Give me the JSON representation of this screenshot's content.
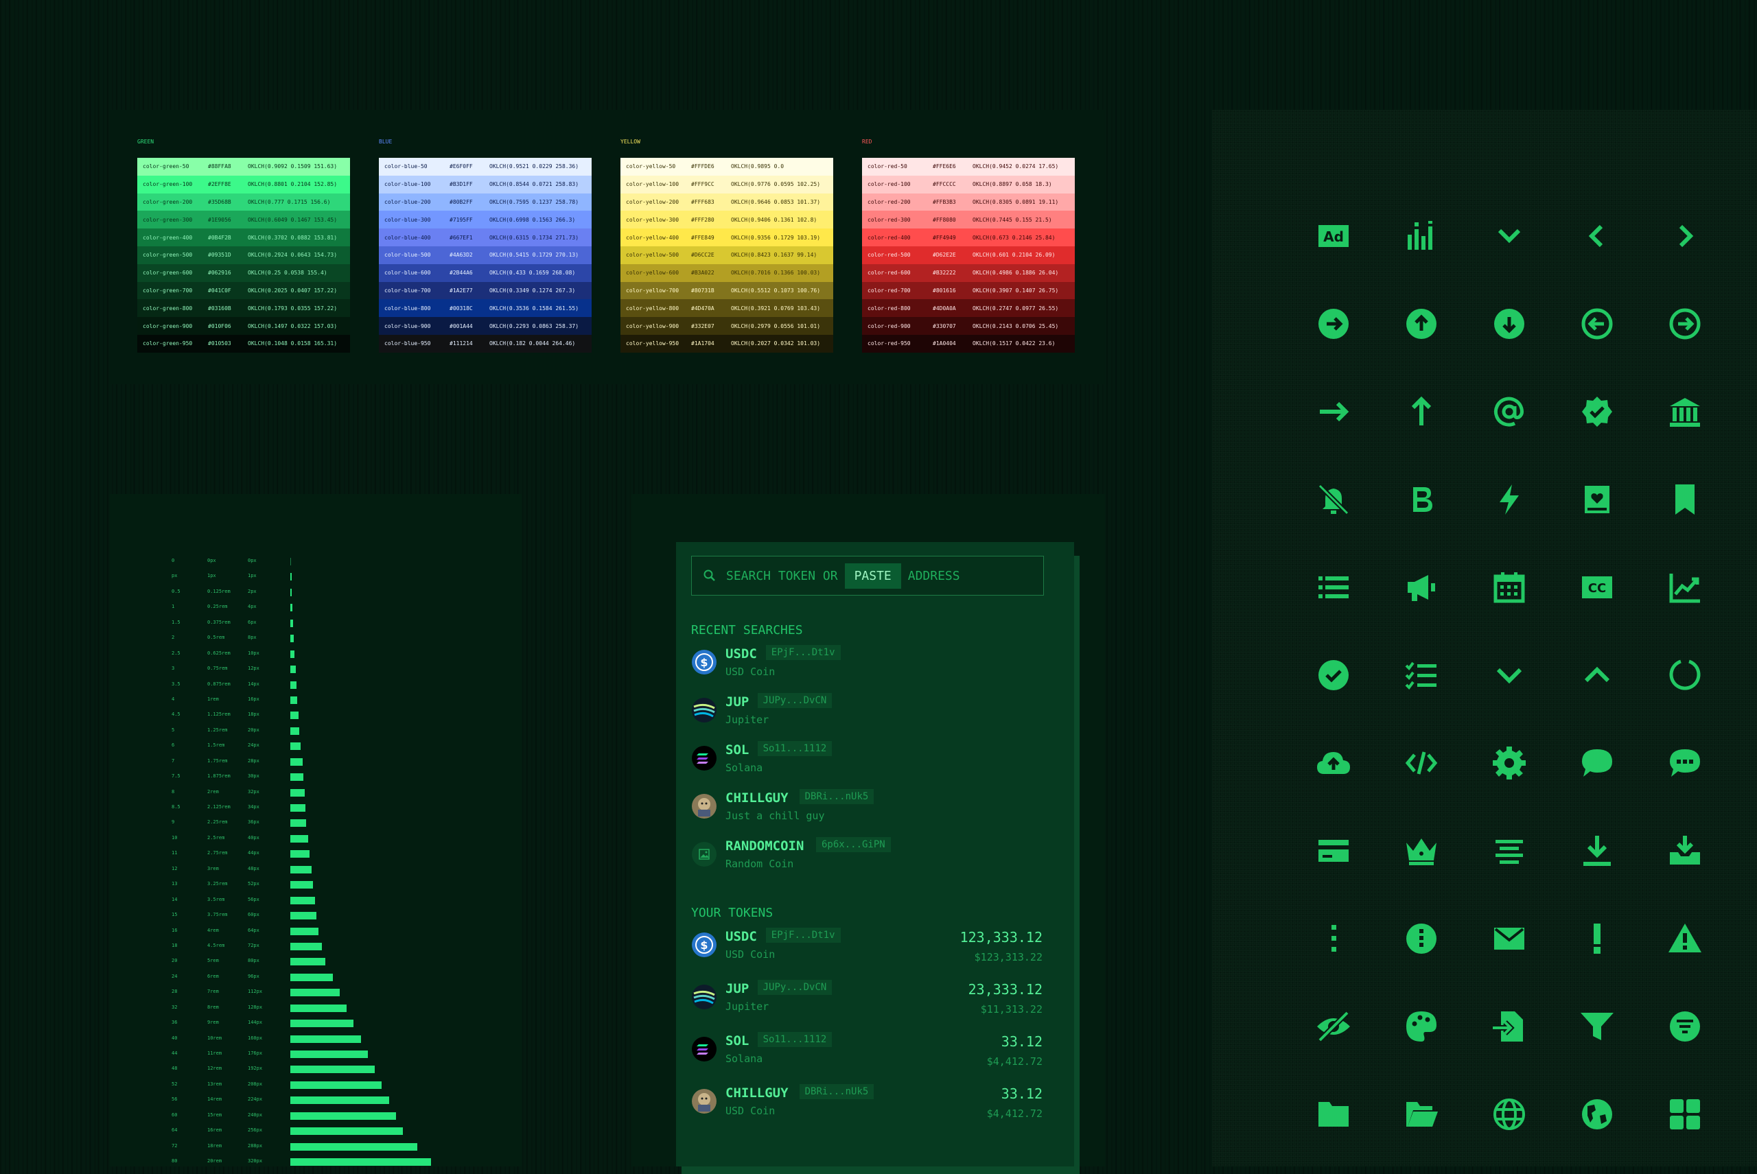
{
  "palettes": [
    {
      "title": "GREEN",
      "title_color": "#2edb78",
      "rows": [
        {
          "name": "color-green-50",
          "hex": "#88FFA8",
          "oklch": "OKLCH(0.9092 0.1509 151.63)",
          "bg": "#88ffa8",
          "fg": "#06351a"
        },
        {
          "name": "color-green-100",
          "hex": "#2EFF8E",
          "oklch": "OKLCH(0.8801 0.2104 152.85)",
          "bg": "#3cf98a",
          "fg": "#06351a"
        },
        {
          "name": "color-green-200",
          "hex": "#35D68B",
          "oklch": "OKLCH(0.777 0.1715 156.6)",
          "bg": "#2ed77a",
          "fg": "#06351a"
        },
        {
          "name": "color-green-300",
          "hex": "#1E9056",
          "oklch": "OKLCH(0.6049 0.1467 153.45)",
          "bg": "#1ba85a",
          "fg": "#06351a"
        },
        {
          "name": "color-green-400",
          "hex": "#0B4F2B",
          "oklch": "OKLCH(0.3702 0.0882 153.81)",
          "bg": "#0f7a3e",
          "fg": "#8ff2b8"
        },
        {
          "name": "color-green-500",
          "hex": "#09351D",
          "oklch": "OKLCH(0.2924 0.0643 154.73)",
          "bg": "#0b5c2f",
          "fg": "#8ff2b8"
        },
        {
          "name": "color-green-600",
          "hex": "#062916",
          "oklch": "OKLCH(0.25 0.0538 155.4)",
          "bg": "#094724",
          "fg": "#8ff2b8"
        },
        {
          "name": "color-green-700",
          "hex": "#041C0F",
          "oklch": "OKLCH(0.2025 0.0407 157.22)",
          "bg": "#07361c",
          "fg": "#8ff2b8"
        },
        {
          "name": "color-green-800",
          "hex": "#03160B",
          "oklch": "OKLCH(0.1793 0.0355 157.22)",
          "bg": "#052814",
          "fg": "#8ff2b8"
        },
        {
          "name": "color-green-900",
          "hex": "#010F06",
          "oklch": "OKLCH(0.1497 0.0322 157.03)",
          "bg": "#031a0d",
          "fg": "#8ff2b8"
        },
        {
          "name": "color-green-950",
          "hex": "#010503",
          "oklch": "OKLCH(0.1048 0.0158 165.31)",
          "bg": "#020a06",
          "fg": "#8ff2b8"
        }
      ]
    },
    {
      "title": "BLUE",
      "title_color": "#5d88ff",
      "rows": [
        {
          "name": "color-blue-50",
          "hex": "#E6F0FF",
          "oklch": "OKLCH(0.9521 0.0229 258.36)",
          "bg": "#e6f0ff",
          "fg": "#0b1b4a"
        },
        {
          "name": "color-blue-100",
          "hex": "#B3D1FF",
          "oklch": "OKLCH(0.8544 0.0721 258.83)",
          "bg": "#b6d0ff",
          "fg": "#0b1b4a"
        },
        {
          "name": "color-blue-200",
          "hex": "#80B2FF",
          "oklch": "OKLCH(0.7595 0.1237 258.78)",
          "bg": "#8fb5ff",
          "fg": "#0b1b4a"
        },
        {
          "name": "color-blue-300",
          "hex": "#7195FF",
          "oklch": "OKLCH(0.6998 0.1563 266.3)",
          "bg": "#7397ff",
          "fg": "#0b1b4a"
        },
        {
          "name": "color-blue-400",
          "hex": "#667EF1",
          "oklch": "OKLCH(0.6315 0.1734 271.73)",
          "bg": "#6a80f2",
          "fg": "#0b1b4a"
        },
        {
          "name": "color-blue-500",
          "hex": "#4A63D2",
          "oklch": "OKLCH(0.5415 0.1729 270.13)",
          "bg": "#4c66d6",
          "fg": "#e6f0ff"
        },
        {
          "name": "color-blue-600",
          "hex": "#2B44A6",
          "oklch": "OKLCH(0.433 0.1659 268.08)",
          "bg": "#2c46a8",
          "fg": "#e6f0ff"
        },
        {
          "name": "color-blue-700",
          "hex": "#1A2E77",
          "oklch": "OKLCH(0.3349 0.1274 267.3)",
          "bg": "#1b2f7a",
          "fg": "#e6f0ff"
        },
        {
          "name": "color-blue-800",
          "hex": "#00318C",
          "oklch": "OKLCH(0.3536 0.1584 261.55)",
          "bg": "#07318c",
          "fg": "#e6f0ff"
        },
        {
          "name": "color-blue-900",
          "hex": "#001A44",
          "oklch": "OKLCH(0.2293 0.0863 258.37)",
          "bg": "#0a1a44",
          "fg": "#e6f0ff"
        },
        {
          "name": "color-blue-950",
          "hex": "#111214",
          "oklch": "OKLCH(0.182 0.0044 264.46)",
          "bg": "#111214",
          "fg": "#e6f0ff"
        }
      ]
    },
    {
      "title": "YELLOW",
      "title_color": "#f1e15b",
      "rows": [
        {
          "name": "color-yellow-50",
          "hex": "#FFFDE6",
          "oklch": "OKLCH(0.9895 0.0",
          "bg": "#fffde6",
          "fg": "#3a3305"
        },
        {
          "name": "color-yellow-100",
          "hex": "#FFF9CC",
          "oklch": "OKLCH(0.9776 0.0595 102.25)",
          "bg": "#fff8c6",
          "fg": "#3a3305"
        },
        {
          "name": "color-yellow-200",
          "hex": "#FFF683",
          "oklch": "OKLCH(0.9646 0.0853 101.37)",
          "bg": "#fff39a",
          "fg": "#3a3305"
        },
        {
          "name": "color-yellow-300",
          "hex": "#FFF280",
          "oklch": "OKLCH(0.9406 0.1361 102.8)",
          "bg": "#ffee6e",
          "fg": "#3a3305"
        },
        {
          "name": "color-yellow-400",
          "hex": "#FFE849",
          "oklch": "OKLCH(0.9356 0.1729 103.19)",
          "bg": "#ffe84a",
          "fg": "#3a3305"
        },
        {
          "name": "color-yellow-500",
          "hex": "#D6CC2E",
          "oklch": "OKLCH(0.8423 0.1637 99.14)",
          "bg": "#d9c830",
          "fg": "#3a3305"
        },
        {
          "name": "color-yellow-600",
          "hex": "#B3A022",
          "oklch": "OKLCH(0.7016 0.1366 100.03)",
          "bg": "#b39f23",
          "fg": "#3a3305"
        },
        {
          "name": "color-yellow-700",
          "hex": "#80731B",
          "oklch": "OKLCH(0.5512 0.1073 100.76)",
          "bg": "#82741d",
          "fg": "#fff8c6"
        },
        {
          "name": "color-yellow-800",
          "hex": "#4D470A",
          "oklch": "OKLCH(0.3921 0.0769 103.43)",
          "bg": "#5a4f10",
          "fg": "#fff8c6"
        },
        {
          "name": "color-yellow-900",
          "hex": "#332E07",
          "oklch": "OKLCH(0.2979 0.0556 101.01)",
          "bg": "#3b340a",
          "fg": "#fff8c6"
        },
        {
          "name": "color-yellow-950",
          "hex": "#1A1704",
          "oklch": "OKLCH(0.2027 0.0342 101.03)",
          "bg": "#1e1b06",
          "fg": "#fff8c6"
        }
      ]
    },
    {
      "title": "RED",
      "title_color": "#ff5a5a",
      "rows": [
        {
          "name": "color-red-50",
          "hex": "#FFE6E6",
          "oklch": "OKLCH(0.9452 0.0274 17.65)",
          "bg": "#ffe6e6",
          "fg": "#3d0707"
        },
        {
          "name": "color-red-100",
          "hex": "#FFCCCC",
          "oklch": "OKLCH(0.8897 0.058 18.3)",
          "bg": "#ffc8c8",
          "fg": "#3d0707"
        },
        {
          "name": "color-red-200",
          "hex": "#FFB3B3",
          "oklch": "OKLCH(0.8305 0.0891 19.11)",
          "bg": "#ffa8a8",
          "fg": "#3d0707"
        },
        {
          "name": "color-red-300",
          "hex": "#FF8080",
          "oklch": "OKLCH(0.7445 0.155 21.5)",
          "bg": "#ff8080",
          "fg": "#3d0707"
        },
        {
          "name": "color-red-400",
          "hex": "#FF4949",
          "oklch": "OKLCH(0.673 0.2146 25.84)",
          "bg": "#ff4d4d",
          "fg": "#3d0707"
        },
        {
          "name": "color-red-500",
          "hex": "#D62E2E",
          "oklch": "OKLCH(0.601 0.2104 26.09)",
          "bg": "#e02c2c",
          "fg": "#ffe6e6"
        },
        {
          "name": "color-red-600",
          "hex": "#B32222",
          "oklch": "OKLCH(0.4986 0.1886 26.04)",
          "bg": "#b32222",
          "fg": "#ffe6e6"
        },
        {
          "name": "color-red-700",
          "hex": "#801616",
          "oklch": "OKLCH(0.3907 0.1407 26.75)",
          "bg": "#8a1818",
          "fg": "#ffe6e6"
        },
        {
          "name": "color-red-800",
          "hex": "#4D0A0A",
          "oklch": "OKLCH(0.2747 0.0977 26.55)",
          "bg": "#5d0d0d",
          "fg": "#ffe6e6"
        },
        {
          "name": "color-red-900",
          "hex": "#330707",
          "oklch": "OKLCH(0.2143 0.0706 25.45)",
          "bg": "#3b0808",
          "fg": "#ffe6e6"
        },
        {
          "name": "color-red-950",
          "hex": "#1A0404",
          "oklch": "OKLCH(0.1517 0.0422 23.6)",
          "bg": "#1e0505",
          "fg": "#ffe6e6"
        }
      ]
    }
  ],
  "spacing": [
    {
      "key": "0",
      "rem": "0px",
      "px": "0px",
      "frac": 0
    },
    {
      "key": "px",
      "rem": "1px",
      "px": "1px",
      "frac": 0.007
    },
    {
      "key": "0.5",
      "rem": "0.125rem",
      "px": "2px",
      "frac": 0.016
    },
    {
      "key": "1",
      "rem": "0.25rem",
      "px": "4px",
      "frac": 0.031
    },
    {
      "key": "1.5",
      "rem": "0.375rem",
      "px": "6px",
      "frac": 0.047
    },
    {
      "key": "2",
      "rem": "0.5rem",
      "px": "8px",
      "frac": 0.063
    },
    {
      "key": "2.5",
      "rem": "0.625rem",
      "px": "10px",
      "frac": 0.078
    },
    {
      "key": "3",
      "rem": "0.75rem",
      "px": "12px",
      "frac": 0.094
    },
    {
      "key": "3.5",
      "rem": "0.875rem",
      "px": "14px",
      "frac": 0.109
    },
    {
      "key": "4",
      "rem": "1rem",
      "px": "16px",
      "frac": 0.125
    },
    {
      "key": "4.5",
      "rem": "1.125rem",
      "px": "18px",
      "frac": 0.141
    },
    {
      "key": "5",
      "rem": "1.25rem",
      "px": "20px",
      "frac": 0.156
    },
    {
      "key": "6",
      "rem": "1.5rem",
      "px": "24px",
      "frac": 0.188
    },
    {
      "key": "7",
      "rem": "1.75rem",
      "px": "28px",
      "frac": 0.219
    },
    {
      "key": "7.5",
      "rem": "1.875rem",
      "px": "30px",
      "frac": 0.234
    },
    {
      "key": "8",
      "rem": "2rem",
      "px": "32px",
      "frac": 0.25
    },
    {
      "key": "8.5",
      "rem": "2.125rem",
      "px": "34px",
      "frac": 0.266
    },
    {
      "key": "9",
      "rem": "2.25rem",
      "px": "36px",
      "frac": 0.281
    },
    {
      "key": "10",
      "rem": "2.5rem",
      "px": "40px",
      "frac": 0.313
    },
    {
      "key": "11",
      "rem": "2.75rem",
      "px": "44px",
      "frac": 0.344
    },
    {
      "key": "12",
      "rem": "3rem",
      "px": "48px",
      "frac": 0.375
    },
    {
      "key": "13",
      "rem": "3.25rem",
      "px": "52px",
      "frac": 0.406
    },
    {
      "key": "14",
      "rem": "3.5rem",
      "px": "56px",
      "frac": 0.438
    },
    {
      "key": "15",
      "rem": "3.75rem",
      "px": "60px",
      "frac": 0.469
    },
    {
      "key": "16",
      "rem": "4rem",
      "px": "64px",
      "frac": 0.5
    },
    {
      "key": "18",
      "rem": "4.5rem",
      "px": "72px",
      "frac": 0.563
    },
    {
      "key": "20",
      "rem": "5rem",
      "px": "80px",
      "frac": 0.625
    },
    {
      "key": "24",
      "rem": "6rem",
      "px": "96px",
      "frac": 0.75
    },
    {
      "key": "28",
      "rem": "7rem",
      "px": "112px",
      "frac": 0.875
    },
    {
      "key": "32",
      "rem": "8rem",
      "px": "128px",
      "frac": 1.0
    },
    {
      "key": "36",
      "rem": "9rem",
      "px": "144px",
      "frac": 1.125
    },
    {
      "key": "40",
      "rem": "10rem",
      "px": "160px",
      "frac": 1.25
    },
    {
      "key": "44",
      "rem": "11rem",
      "px": "176px",
      "frac": 1.375
    },
    {
      "key": "48",
      "rem": "12rem",
      "px": "192px",
      "frac": 1.5
    },
    {
      "key": "52",
      "rem": "13rem",
      "px": "208px",
      "frac": 1.625
    },
    {
      "key": "56",
      "rem": "14rem",
      "px": "224px",
      "frac": 1.75
    },
    {
      "key": "60",
      "rem": "15rem",
      "px": "240px",
      "frac": 1.875
    },
    {
      "key": "64",
      "rem": "16rem",
      "px": "256px",
      "frac": 2.0
    },
    {
      "key": "72",
      "rem": "18rem",
      "px": "288px",
      "frac": 2.25
    },
    {
      "key": "80",
      "rem": "20rem",
      "px": "320px",
      "frac": 2.5
    }
  ],
  "search": {
    "prefix": "SEARCH TOKEN OR",
    "paste_label": "PASTE",
    "suffix": "ADDRESS"
  },
  "recent_title": "RECENT SEARCHES",
  "recent": [
    {
      "symbol": "USDC",
      "addr": "EPjF...Dt1v",
      "name": "USD Coin",
      "icon": "usdc-icon"
    },
    {
      "symbol": "JUP",
      "addr": "JUPy...DvCN",
      "name": "Jupiter",
      "icon": "jupiter-icon"
    },
    {
      "symbol": "SOL",
      "addr": "So11...1112",
      "name": "Solana",
      "icon": "solana-icon"
    },
    {
      "symbol": "CHILLGUY",
      "addr": "DBRi...nUk5",
      "name": "Just a chill guy",
      "icon": "chillguy-icon"
    },
    {
      "symbol": "RANDOMCOIN",
      "addr": "6p6x...GiPN",
      "name": "Random Coin",
      "icon": "image-placeholder-icon"
    }
  ],
  "tokens_title": "YOUR TOKENS",
  "tokens": [
    {
      "symbol": "USDC",
      "addr": "EPjF...Dt1v",
      "name": "USD Coin",
      "balance": "123,333.12",
      "value": "$123,313.22",
      "icon": "usdc-icon"
    },
    {
      "symbol": "JUP",
      "addr": "JUPy...DvCN",
      "name": "Jupiter",
      "balance": "23,333.12",
      "value": "$11,313.22",
      "icon": "jupiter-icon"
    },
    {
      "symbol": "SOL",
      "addr": "So11...1112",
      "name": "Solana",
      "balance": "33.12",
      "value": "$4,412.72",
      "icon": "solana-icon"
    },
    {
      "symbol": "CHILLGUY",
      "addr": "DBRi...nUk5",
      "name": "USD Coin",
      "balance": "33.12",
      "value": "$4,412.72",
      "icon": "chillguy-icon"
    }
  ],
  "icons": [
    "ad-icon",
    "chart-bars-icon",
    "chevron-down-icon",
    "chevron-left-icon",
    "chevron-right-icon",
    "arrow-circle-right-icon",
    "arrow-circle-up-icon",
    "arrow-circle-down-icon",
    "arrow-circle-left-icon",
    "arrow-circle-right-outline-icon",
    "arrow-right-icon",
    "arrow-up-icon",
    "at-icon",
    "verified-badge-icon",
    "bank-icon",
    "bell-off-icon",
    "bold-icon",
    "lightning-icon",
    "book-heart-icon",
    "bookmark-icon",
    "bullet-list-icon",
    "megaphone-icon",
    "calendar-icon",
    "closed-captions-icon",
    "chart-line-icon",
    "check-circle-icon",
    "checklist-icon",
    "chevron-down-2-icon",
    "chevron-up-icon",
    "circle-loader-icon",
    "cloud-upload-icon",
    "code-icon",
    "gear-icon",
    "chat-bubble-icon",
    "chat-dots-icon",
    "credit-card-icon",
    "crown-icon",
    "align-center-icon",
    "download-icon",
    "download-tray-icon",
    "dots-vertical-icon",
    "info-circle-icon",
    "mail-icon",
    "exclamation-icon",
    "warning-icon",
    "eye-off-icon",
    "palette-icon",
    "file-import-icon",
    "filter-icon",
    "filter-circle-icon",
    "folder-icon",
    "folder-open-icon",
    "globe-icon",
    "globe-americas-icon",
    "grid-icon"
  ],
  "icon_color": "#22c863"
}
